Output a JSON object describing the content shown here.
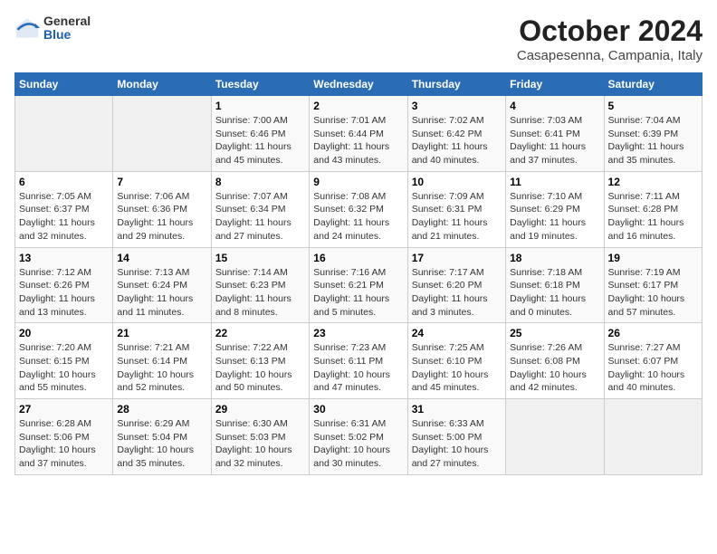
{
  "logo": {
    "general": "General",
    "blue": "Blue"
  },
  "title": "October 2024",
  "subtitle": "Casapesenna, Campania, Italy",
  "weekdays": [
    "Sunday",
    "Monday",
    "Tuesday",
    "Wednesday",
    "Thursday",
    "Friday",
    "Saturday"
  ],
  "weeks": [
    [
      {
        "day": "",
        "info": ""
      },
      {
        "day": "",
        "info": ""
      },
      {
        "day": "1",
        "info": "Sunrise: 7:00 AM\nSunset: 6:46 PM\nDaylight: 11 hours and 45 minutes."
      },
      {
        "day": "2",
        "info": "Sunrise: 7:01 AM\nSunset: 6:44 PM\nDaylight: 11 hours and 43 minutes."
      },
      {
        "day": "3",
        "info": "Sunrise: 7:02 AM\nSunset: 6:42 PM\nDaylight: 11 hours and 40 minutes."
      },
      {
        "day": "4",
        "info": "Sunrise: 7:03 AM\nSunset: 6:41 PM\nDaylight: 11 hours and 37 minutes."
      },
      {
        "day": "5",
        "info": "Sunrise: 7:04 AM\nSunset: 6:39 PM\nDaylight: 11 hours and 35 minutes."
      }
    ],
    [
      {
        "day": "6",
        "info": "Sunrise: 7:05 AM\nSunset: 6:37 PM\nDaylight: 11 hours and 32 minutes."
      },
      {
        "day": "7",
        "info": "Sunrise: 7:06 AM\nSunset: 6:36 PM\nDaylight: 11 hours and 29 minutes."
      },
      {
        "day": "8",
        "info": "Sunrise: 7:07 AM\nSunset: 6:34 PM\nDaylight: 11 hours and 27 minutes."
      },
      {
        "day": "9",
        "info": "Sunrise: 7:08 AM\nSunset: 6:32 PM\nDaylight: 11 hours and 24 minutes."
      },
      {
        "day": "10",
        "info": "Sunrise: 7:09 AM\nSunset: 6:31 PM\nDaylight: 11 hours and 21 minutes."
      },
      {
        "day": "11",
        "info": "Sunrise: 7:10 AM\nSunset: 6:29 PM\nDaylight: 11 hours and 19 minutes."
      },
      {
        "day": "12",
        "info": "Sunrise: 7:11 AM\nSunset: 6:28 PM\nDaylight: 11 hours and 16 minutes."
      }
    ],
    [
      {
        "day": "13",
        "info": "Sunrise: 7:12 AM\nSunset: 6:26 PM\nDaylight: 11 hours and 13 minutes."
      },
      {
        "day": "14",
        "info": "Sunrise: 7:13 AM\nSunset: 6:24 PM\nDaylight: 11 hours and 11 minutes."
      },
      {
        "day": "15",
        "info": "Sunrise: 7:14 AM\nSunset: 6:23 PM\nDaylight: 11 hours and 8 minutes."
      },
      {
        "day": "16",
        "info": "Sunrise: 7:16 AM\nSunset: 6:21 PM\nDaylight: 11 hours and 5 minutes."
      },
      {
        "day": "17",
        "info": "Sunrise: 7:17 AM\nSunset: 6:20 PM\nDaylight: 11 hours and 3 minutes."
      },
      {
        "day": "18",
        "info": "Sunrise: 7:18 AM\nSunset: 6:18 PM\nDaylight: 11 hours and 0 minutes."
      },
      {
        "day": "19",
        "info": "Sunrise: 7:19 AM\nSunset: 6:17 PM\nDaylight: 10 hours and 57 minutes."
      }
    ],
    [
      {
        "day": "20",
        "info": "Sunrise: 7:20 AM\nSunset: 6:15 PM\nDaylight: 10 hours and 55 minutes."
      },
      {
        "day": "21",
        "info": "Sunrise: 7:21 AM\nSunset: 6:14 PM\nDaylight: 10 hours and 52 minutes."
      },
      {
        "day": "22",
        "info": "Sunrise: 7:22 AM\nSunset: 6:13 PM\nDaylight: 10 hours and 50 minutes."
      },
      {
        "day": "23",
        "info": "Sunrise: 7:23 AM\nSunset: 6:11 PM\nDaylight: 10 hours and 47 minutes."
      },
      {
        "day": "24",
        "info": "Sunrise: 7:25 AM\nSunset: 6:10 PM\nDaylight: 10 hours and 45 minutes."
      },
      {
        "day": "25",
        "info": "Sunrise: 7:26 AM\nSunset: 6:08 PM\nDaylight: 10 hours and 42 minutes."
      },
      {
        "day": "26",
        "info": "Sunrise: 7:27 AM\nSunset: 6:07 PM\nDaylight: 10 hours and 40 minutes."
      }
    ],
    [
      {
        "day": "27",
        "info": "Sunrise: 6:28 AM\nSunset: 5:06 PM\nDaylight: 10 hours and 37 minutes."
      },
      {
        "day": "28",
        "info": "Sunrise: 6:29 AM\nSunset: 5:04 PM\nDaylight: 10 hours and 35 minutes."
      },
      {
        "day": "29",
        "info": "Sunrise: 6:30 AM\nSunset: 5:03 PM\nDaylight: 10 hours and 32 minutes."
      },
      {
        "day": "30",
        "info": "Sunrise: 6:31 AM\nSunset: 5:02 PM\nDaylight: 10 hours and 30 minutes."
      },
      {
        "day": "31",
        "info": "Sunrise: 6:33 AM\nSunset: 5:00 PM\nDaylight: 10 hours and 27 minutes."
      },
      {
        "day": "",
        "info": ""
      },
      {
        "day": "",
        "info": ""
      }
    ]
  ]
}
